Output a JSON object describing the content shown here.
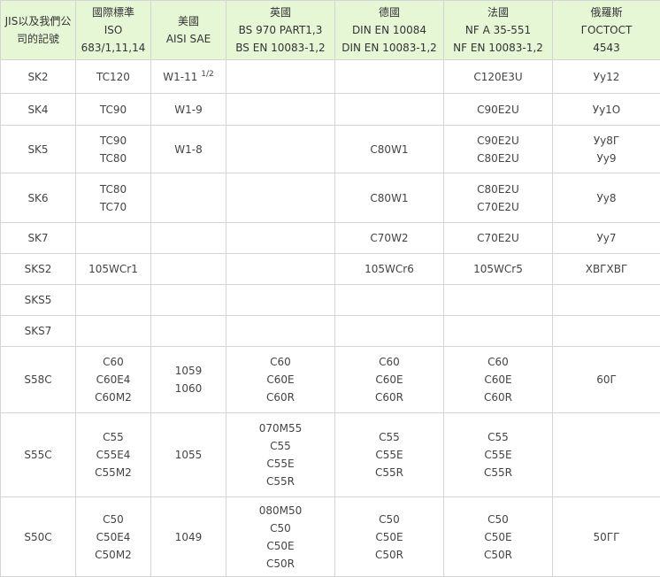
{
  "header": [
    [
      "JIS以及我們公",
      "司的記號"
    ],
    [
      "國際標準",
      "ISO",
      "683/1,11,14"
    ],
    [
      "美國",
      "AISI SAE"
    ],
    [
      "英國",
      "BS 970 PART1,3",
      "BS EN 10083-1,2"
    ],
    [
      "德國",
      "DIN EN 10084",
      "DIN EN 10083-1,2"
    ],
    [
      "法國",
      "NF A 35-551",
      "NF EN 10083-1,2"
    ],
    [
      "俄羅斯",
      "ГОСТОСТ",
      "4543"
    ]
  ],
  "rows": [
    {
      "jis": [
        "SK2"
      ],
      "iso": [
        "TC120"
      ],
      "aisi": [
        {
          "base": "W1-11 ",
          "sup": "1/2"
        }
      ],
      "bs": [],
      "din": [],
      "nf": [
        "C120E3U"
      ],
      "gost": [
        "Уу12"
      ]
    },
    {
      "jis": [
        "SK4"
      ],
      "iso": [
        "TC90"
      ],
      "aisi": [
        "W1-9"
      ],
      "bs": [],
      "din": [],
      "nf": [
        "C90E2U"
      ],
      "gost": [
        "Уу1О"
      ]
    },
    {
      "jis": [
        "SK5"
      ],
      "iso": [
        "TC90",
        "TC80"
      ],
      "aisi": [
        "W1-8"
      ],
      "bs": [],
      "din": [
        "C80W1"
      ],
      "nf": [
        "C90E2U",
        "C80E2U"
      ],
      "gost": [
        "Уу8Г",
        "Уу9"
      ]
    },
    {
      "jis": [
        "SK6"
      ],
      "iso": [
        "TC80",
        "TC70"
      ],
      "aisi": [],
      "bs": [],
      "din": [
        "C80W1"
      ],
      "nf": [
        "C80E2U",
        "C70E2U"
      ],
      "gost": [
        "Уу8"
      ]
    },
    {
      "jis": [
        "SK7"
      ],
      "iso": [],
      "aisi": [],
      "bs": [],
      "din": [
        "C70W2"
      ],
      "nf": [
        "C70E2U"
      ],
      "gost": [
        "Уу7"
      ]
    },
    {
      "jis": [
        "SKS2"
      ],
      "iso": [
        "105WCr1"
      ],
      "aisi": [],
      "bs": [],
      "din": [
        "105WCr6"
      ],
      "nf": [
        "105WCr5"
      ],
      "gost": [
        "ХВГХВГ"
      ]
    },
    {
      "jis": [
        "SKS5"
      ],
      "iso": [],
      "aisi": [],
      "bs": [],
      "din": [],
      "nf": [],
      "gost": []
    },
    {
      "jis": [
        "SKS7"
      ],
      "iso": [],
      "aisi": [],
      "bs": [],
      "din": [],
      "nf": [],
      "gost": []
    },
    {
      "jis": [
        "S58C"
      ],
      "iso": [
        "C60",
        "C60E4",
        "C60M2"
      ],
      "aisi": [
        "1059",
        "1060"
      ],
      "bs": [
        "C60",
        "C60E",
        "C60R"
      ],
      "din": [
        "C60",
        "C60E",
        "C60R"
      ],
      "nf": [
        "C60",
        "C60E",
        "C60R"
      ],
      "gost": [
        "60Г"
      ]
    },
    {
      "jis": [
        "S55C"
      ],
      "iso": [
        "C55",
        "C55E4",
        "C55M2"
      ],
      "aisi": [
        "1055"
      ],
      "bs": [
        "070M55",
        "C55",
        "C55E",
        "C55R"
      ],
      "din": [
        "C55",
        "C55E",
        "C55R"
      ],
      "nf": [
        "C55",
        "C55E",
        "C55R"
      ],
      "gost": []
    },
    {
      "jis": [
        "S50C"
      ],
      "iso": [
        "C50",
        "C50E4",
        "C50M2"
      ],
      "aisi": [
        "1049"
      ],
      "bs": [
        "080M50",
        "C50",
        "C50E",
        "C50R"
      ],
      "din": [
        "C50",
        "C50E",
        "C50R"
      ],
      "nf": [
        "C50",
        "C50E",
        "C50R"
      ],
      "gost": [
        "50ГГ"
      ]
    }
  ]
}
